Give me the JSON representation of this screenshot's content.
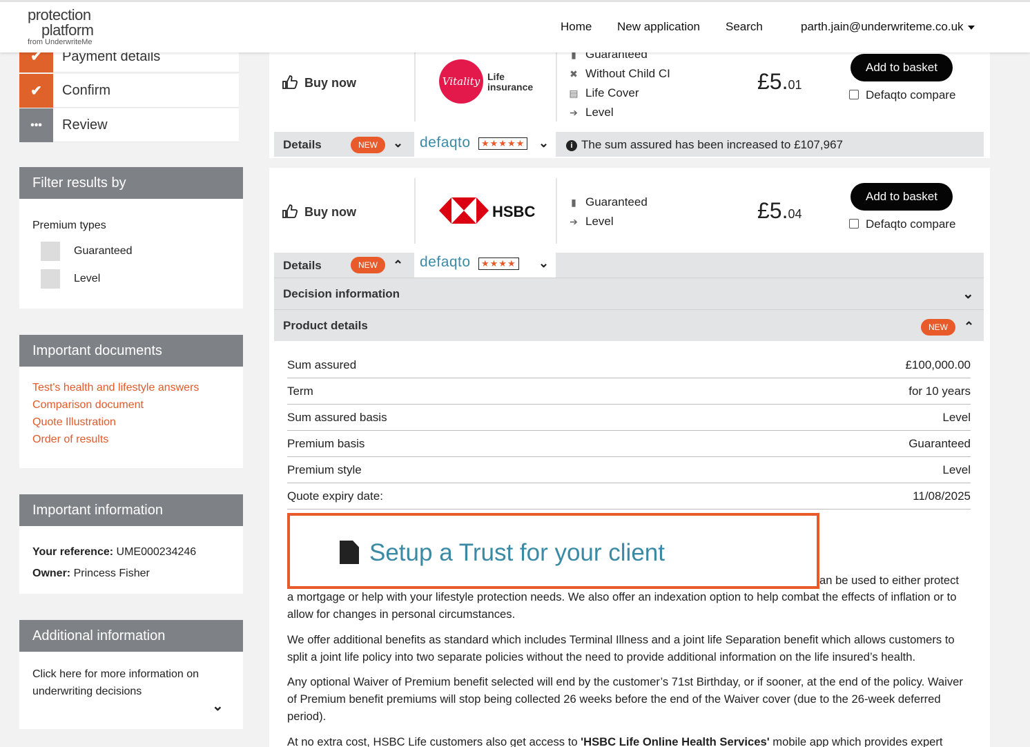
{
  "header": {
    "logo": {
      "line1": "protection",
      "line2": "platform",
      "line3": "from UnderwriteMe"
    },
    "nav": {
      "home": "Home",
      "new_application": "New application",
      "search": "Search",
      "user": "parth.jain@underwriteme.co.uk"
    }
  },
  "steps": [
    {
      "label": "Payment details",
      "state": "done",
      "color": "#e0622b"
    },
    {
      "label": "Confirm",
      "state": "done",
      "color": "#e0622b"
    },
    {
      "label": "Review",
      "state": "pending",
      "color": "#7e8286"
    }
  ],
  "filter": {
    "title": "Filter results by",
    "subtitle": "Premium types",
    "options": [
      "Guaranteed",
      "Level"
    ]
  },
  "documents": {
    "title": "Important documents",
    "links": [
      "Test's health and lifestyle answers",
      "Comparison document",
      "Quote Illustration",
      "Order of results"
    ]
  },
  "info": {
    "title": "Important information",
    "reference_label": "Your reference:",
    "reference_value": "UME000234246",
    "owner_label": "Owner:",
    "owner_value": "Princess Fisher"
  },
  "additional": {
    "title": "Additional information",
    "text": "Click here for more information on underwriting decisions"
  },
  "results": [
    {
      "provider": "Vitality Life insurance",
      "logo_text": "Vitality",
      "logo_sub1": "Life",
      "logo_sub2": "insurance",
      "buy_label": "Buy now",
      "features": [
        "Guaranteed",
        "Without Child CI",
        "Life Cover",
        "Level"
      ],
      "price_main": "£5.",
      "price_pence": "01",
      "basket_label": "Add to basket",
      "compare_label": "Defaqto compare",
      "details_label": "Details",
      "new_label": "NEW",
      "defaqto": "defaqto",
      "stars": "★★★★★",
      "notice": "The sum assured has been increased to £107,967"
    },
    {
      "provider": "HSBC",
      "logo_text": "HSBC",
      "buy_label": "Buy now",
      "features": [
        "Guaranteed",
        "Level"
      ],
      "price_main": "£5.",
      "price_pence": "04",
      "basket_label": "Add to basket",
      "compare_label": "Defaqto compare",
      "details_label": "Details",
      "new_label": "NEW",
      "defaqto": "defaqto",
      "stars": "★★★★"
    }
  ],
  "accordion": {
    "decision": "Decision information",
    "product": "Product details",
    "new_label": "NEW"
  },
  "product_details": [
    {
      "key": "Sum assured",
      "value": "£100,000.00"
    },
    {
      "key": "Term",
      "value": "for 10 years"
    },
    {
      "key": "Sum assured basis",
      "value": "Level"
    },
    {
      "key": "Premium basis",
      "value": "Guaranteed"
    },
    {
      "key": "Premium style",
      "value": "Level"
    },
    {
      "key": "Quote expiry date:",
      "value": "11/08/2025"
    }
  ],
  "trust": {
    "label": "Setup a Trust for your client"
  },
  "paragraphs": {
    "p1_tail": "an be used to either protect",
    "p1_rest": "a mortgage or help with your lifestyle protection needs. We also offer an indexation option to help combat the effects of inflation or to allow for changes in personal circumstances.",
    "p2": "We offer additional benefits as standard which includes Terminal Illness and a joint life Separation benefit which allows customers to split a joint life policy into two separate policies without the need to provide additional information on the life insured’s health.",
    "p3": "Any optional Waiver of Premium benefit selected will end by the customer’s 71st Birthday, or if sooner, at the end of the policy. Waiver of Premium benefit premiums will stop being collected 26 weeks before the end of the Waiver cover (due to the 26-week deferred period).",
    "p4_start": "At no extra cost, HSBC Life customers also get access to ",
    "p4_bold": "'HSBC Life Online Health Services'",
    "p4_end": " mobile app which provides expert"
  },
  "colors": {
    "accent": "#e0622b",
    "panel_header": "#7e8286",
    "teal": "#3a8aa5",
    "vitality": "#e3194b",
    "hsbc": "#db0011"
  }
}
